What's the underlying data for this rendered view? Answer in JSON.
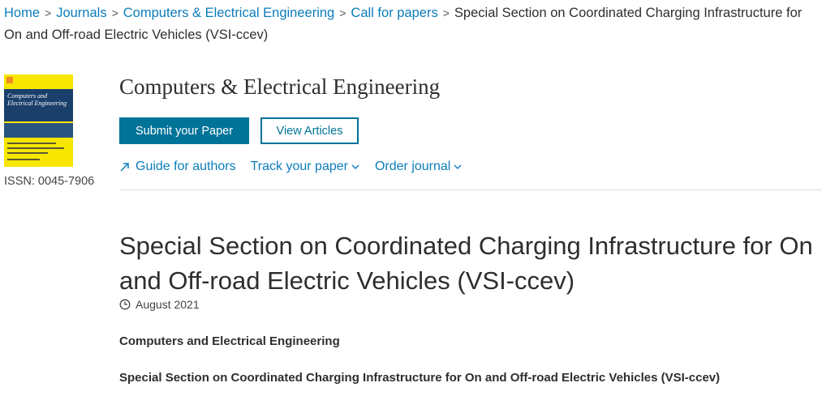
{
  "breadcrumb": {
    "items": [
      "Home",
      "Journals",
      "Computers & Electrical Engineering",
      "Call for papers"
    ],
    "current": "Special Section on Coordinated Charging Infrastructure for On and Off-road Electric Vehicles (VSI-ccev)",
    "separator": ">"
  },
  "journal": {
    "title": "Computers & Electrical Engineering",
    "issn": "ISSN: 0045-7906",
    "cover_title": "Computers and Electrical Engineering"
  },
  "actions": {
    "submit_label": "Submit your Paper",
    "view_label": "View Articles"
  },
  "links": {
    "guide": "Guide for authors",
    "track": "Track your paper",
    "order": "Order journal"
  },
  "article": {
    "title": "Special Section on Coordinated Charging Infrastructure for On and Off-road Electric Vehicles (VSI-ccev)",
    "date": "August 2021",
    "section_journal": "Computers and Electrical Engineering",
    "section_title": "Special Section on Coordinated Charging Infrastructure for On and Off-road Electric Vehicles (VSI-ccev)"
  },
  "colors": {
    "accent": "#007398",
    "link": "#0c7dbb",
    "text": "#2e2e2e"
  }
}
